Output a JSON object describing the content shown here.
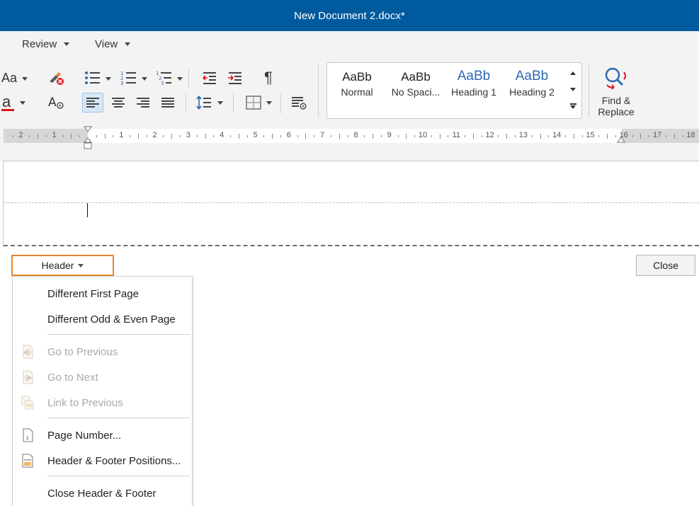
{
  "titlebar": {
    "title": "New Document 2.docx*"
  },
  "menu": {
    "items": [
      "Review",
      "View"
    ]
  },
  "ribbon": {
    "font_size_glyph": "Aa",
    "font_color_glyph": "a",
    "pilcrow": "¶",
    "styles": [
      {
        "sample": "AaBb",
        "label": "Normal"
      },
      {
        "sample": "AaBb",
        "label": "No Spaci..."
      },
      {
        "sample": "AaBb",
        "label": "Heading 1"
      },
      {
        "sample": "AaBb",
        "label": "Heading 2"
      }
    ],
    "find_replace": "Find & Replace",
    "colors": {
      "font_underline": "#e0101a",
      "heading_blue": "#2e67b1",
      "title_bar": "#005a9e"
    }
  },
  "ruler": {
    "left_labels": [
      "2",
      "1"
    ],
    "labels": [
      "1",
      "2",
      "3",
      "4",
      "5",
      "6",
      "7",
      "8",
      "9",
      "10",
      "11",
      "12",
      "13",
      "14",
      "15",
      "16",
      "17",
      "18"
    ]
  },
  "document": {
    "header_tab": "Header",
    "close_button": "Close",
    "accent_color": "#e8852b"
  },
  "dropdown": {
    "items": [
      {
        "label": "Different First Page",
        "enabled": true,
        "icon": "none"
      },
      {
        "label": "Different Odd & Even Page",
        "enabled": true,
        "icon": "none"
      },
      {
        "label": "Go to Previous",
        "enabled": false,
        "icon": "go-previous-icon"
      },
      {
        "label": "Go to Next",
        "enabled": false,
        "icon": "go-next-icon"
      },
      {
        "label": "Link to Previous",
        "enabled": false,
        "icon": "link-previous-icon"
      },
      {
        "label": "Page Number...",
        "enabled": true,
        "icon": "page-number-icon"
      },
      {
        "label": "Header & Footer Positions...",
        "enabled": true,
        "icon": "header-footer-positions-icon"
      },
      {
        "label": "Close Header & Footer",
        "enabled": true,
        "icon": "none"
      }
    ]
  }
}
